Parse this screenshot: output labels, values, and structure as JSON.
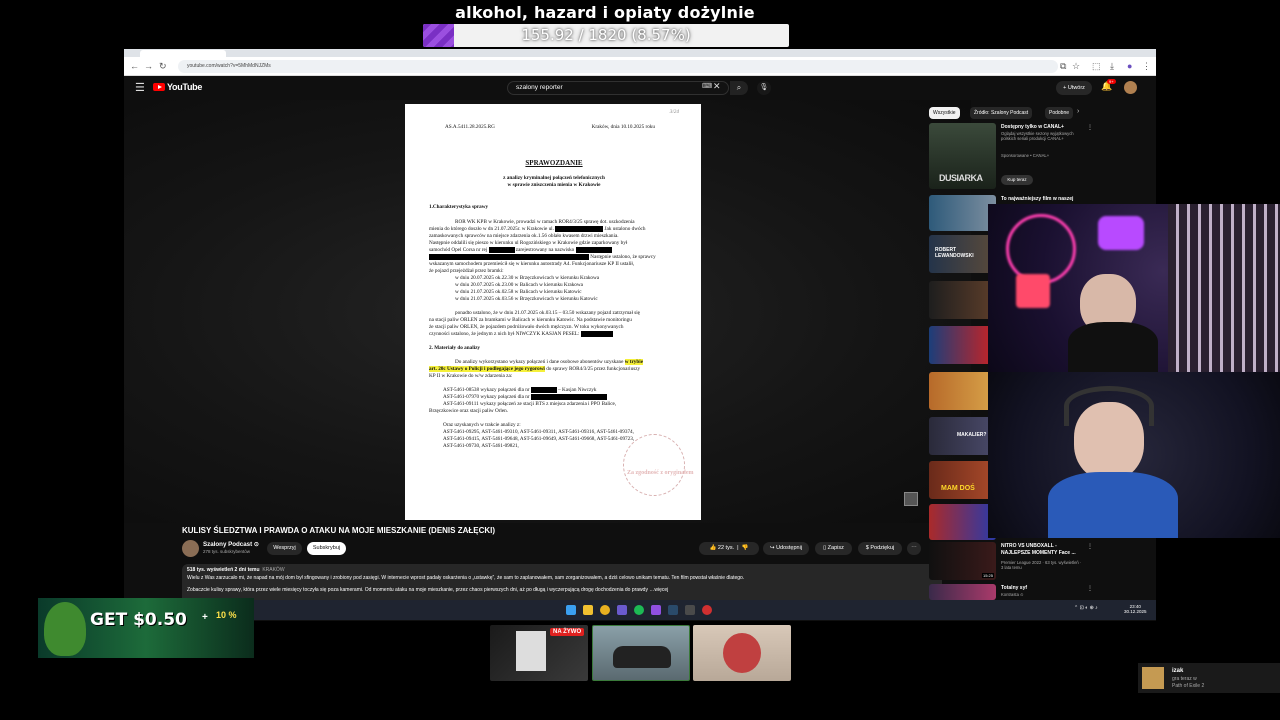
{
  "overlay": {
    "goal_title": "alkohol, hazard i opiaty dożylnie",
    "goal_progress_text": "155.92 / 1820 (8.57%)",
    "goal_progress_fraction": 0.0857,
    "accent_color": "#7a2fc4"
  },
  "browser": {
    "url": "youtube.com/watch?v=5MhMdNJZMs",
    "tabs": [
      "",
      "",
      ""
    ]
  },
  "youtube": {
    "logo_text": "YouTube",
    "search_value": "szalony reporter",
    "create_label": "Utwórz",
    "notif_count": "9+"
  },
  "document": {
    "ref": "AS.A.5411.28.2025.RG",
    "place_date": "Kraków, dnia 10.10.2025 roku",
    "corner_note": "3/24",
    "title": "SPRAWOZDANIE",
    "subtitle1": "z analizy kryminalnej połączeń telefonicznych",
    "subtitle2": "w sprawie zniszczenia mienia w Krakowie",
    "section1": "1.Charakterystyka sprawy",
    "p1a": "ROR WK KPB w Krakowie, prowadzi w ramach ROR4/3/25 sprawę dot. uszkodzenia",
    "p1b": "mienia do którego doszło w dn 21.07.2025r. w Krakowie ul.",
    "p1c": "Jak ustalono dwóch",
    "p1d": "zamaskowanych sprawców na miejsce zdarzenia ok.1.56 oblało kwasem drzwi mieszkania.",
    "p1e": "Następnie oddalili się pieszo w kierunku ul Rogozińskiego w Krakowie gdzie zaparkowany był",
    "p1f": "samochód Opel Corsa nr rej",
    "p1g": "zarejestrowany na nazwisko",
    "p1h": "Następnie ustalono, że sprawcy",
    "p1i": "wskazanym samochodem przemieścił się w kierunku autostrady A4. Funkcjonariusze KP II ustalił,",
    "p1j": "że pojazd przejeżdżał przez bramki:",
    "routes": [
      "w dniu 20.07.2025 ok.22.30 w Brzęczkowicach w kierunku Krakowa",
      "w dniu 20.07.2025 ok.23.00 w Balicach w kierunku Krakowa",
      "w dniu 21.07.2025 ok.02.58 w Balicach w kierunku Katowic",
      "w dniu 21.07.2025 ok.03.56 w Brzęczkowicach w kierunku Katowic"
    ],
    "p2a": "ponadto ustalono, że w dniu 21.07.2025 ok.03.15 – 03.50 wskazany pojazd zatrzymał się",
    "p2b": "na stacji paliw ORLEN za bramkami w Balicach w kierunku Katowic. Na podstawie monitoringu",
    "p2c": "że stacji paliw ORLEN, że pojazdem podróżowało dwóch mężczyzn. W toku wykonywanych",
    "p2d": "czynności ustalono, że jednym z nich był NIWCZYK KASJAN PESEL:",
    "section2": "2. Materiały do analizy",
    "p3a": "Do analizy wykorzystano wykazy połączeń i dane osobowe abonentów uzyskane",
    "p3a_hl": "w trybie",
    "p3b_hl": "art. 20c Ustawy o Policji i podlegające jego rygorowi",
    "p3b": "do sprawy ROR4/3/25 przez funkcjonariuszy",
    "p3c": "KP II w Krakowie do w/w zdarzenia za:",
    "list1a": "AST-5461-08538 wykazy połączeń dla nr",
    "list1a_tail": "– Kasjan Niwczyk",
    "list1b": "AST-5461-07970 wykazy połączeń dla nr",
    "list1c": "AST-5461-09111 wykazy połączeń ze stacji BTS z miejsca zdarzenia i PPO Balice,",
    "list1d": "Brzęczkowice oraz stacji paliw Orlen.",
    "p4a": "Oraz uzyskanych w trakcie analizy z:",
    "p4b": "AST-5461-09295, AST-5461-09310, AST-5461-09311, AST-5461-09316, AST-5461-09374,",
    "p4c": "AST-5461-09415, AST-5461-09648, AST-5461-09649, AST-5461-09668, AST-5461-09723,",
    "p4d": "AST-5461-09730, AST-5461-09821,",
    "stamp_text": "Za zgodność z oryginałem"
  },
  "video_meta": {
    "title": "KULISY ŚLEDZTWA I PRAWDA O ATAKU NA MOJE MIESZKANIE (DENIS ZAŁĘCKI)",
    "channel": "Szalony Podcast ⊙",
    "subs": "278 tys. subskrybentów",
    "support": "Wesprzyj",
    "subscribe": "Subskrybuj",
    "likes": "22 tys.",
    "share": "Udostępnij",
    "save": "Zapisz",
    "thanks": "Podziękuj",
    "more": "⋯"
  },
  "description": {
    "stats": "518 tys. wyświetleń  2 dni temu",
    "tag": "KRAKÓW",
    "line1": "Wielu z Was zarzucało mi, że napad na mój dom był sfingowany i zrobiony pod zasięgi. W internecie wprost padały oskarżenia o „ustawkę”, że sam to zaplanowałem, sam zorganizowałem, a dziś celowo unikam tematu. Ten film powstał właśnie dlatego.",
    "line2": "Zobaczcie kulisy sprawy, która przez wiele miesięcy toczyła się poza kamerami. Od momentu ataku na moje mieszkanie, przez chaos pierwszych dni, aż po długą i wyczerpującą drogę dochodzenia do prawdy …więcej"
  },
  "sidebar": {
    "chips": [
      "Wszystkie",
      "Źródło: Szalony Podcast",
      "Podobne"
    ],
    "ad": {
      "title": "Dostępny tylko w CANAL+",
      "desc": "Oglądaj wszystkie sezony wyjątkowych polskich seriali produkcji CANAL+",
      "sponsor": "Sponsorowane • CANAL+",
      "cta": "Kup teraz",
      "thumb_text": "DUSIARKA"
    },
    "recs": [
      {
        "title": "To najważniejszy film w naszej",
        "meta": ""
      },
      {
        "title": "",
        "meta": "",
        "thumb_text": "ROBERT LEWANDOWSKI"
      },
      {
        "title": "",
        "meta": ""
      },
      {
        "title": "",
        "meta": ""
      },
      {
        "title": "",
        "meta": ""
      },
      {
        "title": "",
        "meta": "",
        "thumb_text": "MAKALIER?"
      },
      {
        "title": "",
        "meta": "",
        "thumb_text": "MAM DOŚ"
      },
      {
        "title": "",
        "meta": ""
      },
      {
        "title": "NITRO VS UNBOXALL - NAJLEPSZE MOMENTY Face ...",
        "meta": "Premier League 2022 · 63 tys. wyświetleń · 3 lata temu",
        "duration": "15:25"
      },
      {
        "title": "Totalny syf",
        "meta": "Kontrasta ⊙"
      }
    ]
  },
  "taskbar": {
    "time": "23:40",
    "date": "30.12.2025"
  },
  "bottom": {
    "ad_text": "GET $0.50",
    "ad_plus": "+",
    "ad_pct": "10 %",
    "live_badge": "NA ŻYWO",
    "notif_name": "izak",
    "notif_status": "gra teraz w",
    "notif_game": "Path of Exile 2"
  }
}
